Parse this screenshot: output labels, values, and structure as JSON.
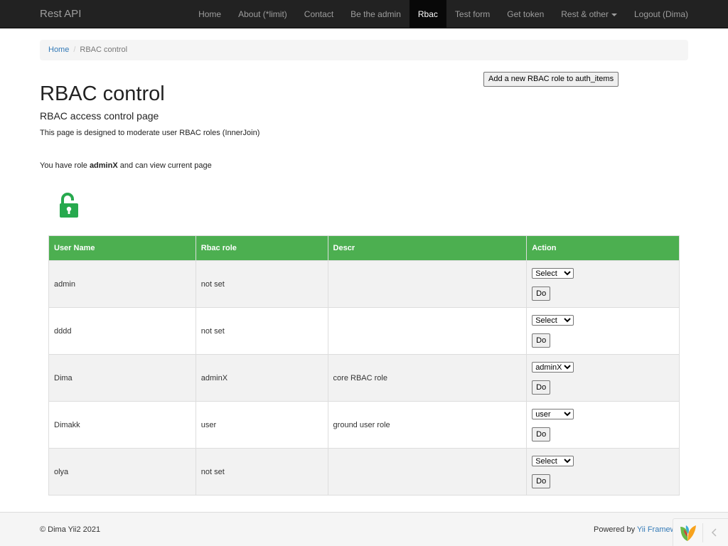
{
  "navbar": {
    "brand": "Rest API",
    "items": [
      {
        "label": "Home"
      },
      {
        "label": "About (*limit)"
      },
      {
        "label": "Contact"
      },
      {
        "label": "Be the admin"
      },
      {
        "label": "Rbac",
        "active": true
      },
      {
        "label": "Test form"
      },
      {
        "label": "Get token"
      },
      {
        "label": "Rest & other"
      },
      {
        "label": "Logout (Dima)"
      }
    ]
  },
  "breadcrumb": {
    "home": "Home",
    "separator": "/",
    "current": "RBAC control"
  },
  "main": {
    "add_role_button": "Add a new RBAC role to auth_items",
    "title": "RBAC control",
    "subtitle": "RBAC access control page",
    "description": "This page is designed to moderate user RBAC roles (InnerJoin)",
    "role_prefix": "You have role ",
    "role_name": "adminX",
    "role_suffix": " and can view current page",
    "lock_icon": "unlock-icon",
    "lock_color": "#27a94e"
  },
  "table": {
    "header_color": "#4caf50",
    "columns": [
      "User Name",
      "Rbac role",
      "Descr",
      "Action"
    ],
    "do_label": "Do",
    "rows": [
      {
        "user": "admin",
        "role": "not set",
        "descr": "",
        "select": "Select"
      },
      {
        "user": "dddd",
        "role": "not set",
        "descr": "",
        "select": "Select"
      },
      {
        "user": "Dima",
        "role": "adminX",
        "descr": "core RBAC role",
        "select": "adminX"
      },
      {
        "user": "Dimakk",
        "role": "user",
        "descr": "ground user role",
        "select": "user"
      },
      {
        "user": "olya",
        "role": "not set",
        "descr": "",
        "select": "Select"
      }
    ]
  },
  "footer": {
    "copyright": "© Dima Yii2 2021",
    "powered_prefix": "Powered by ",
    "powered_link": "Yii Framew"
  }
}
